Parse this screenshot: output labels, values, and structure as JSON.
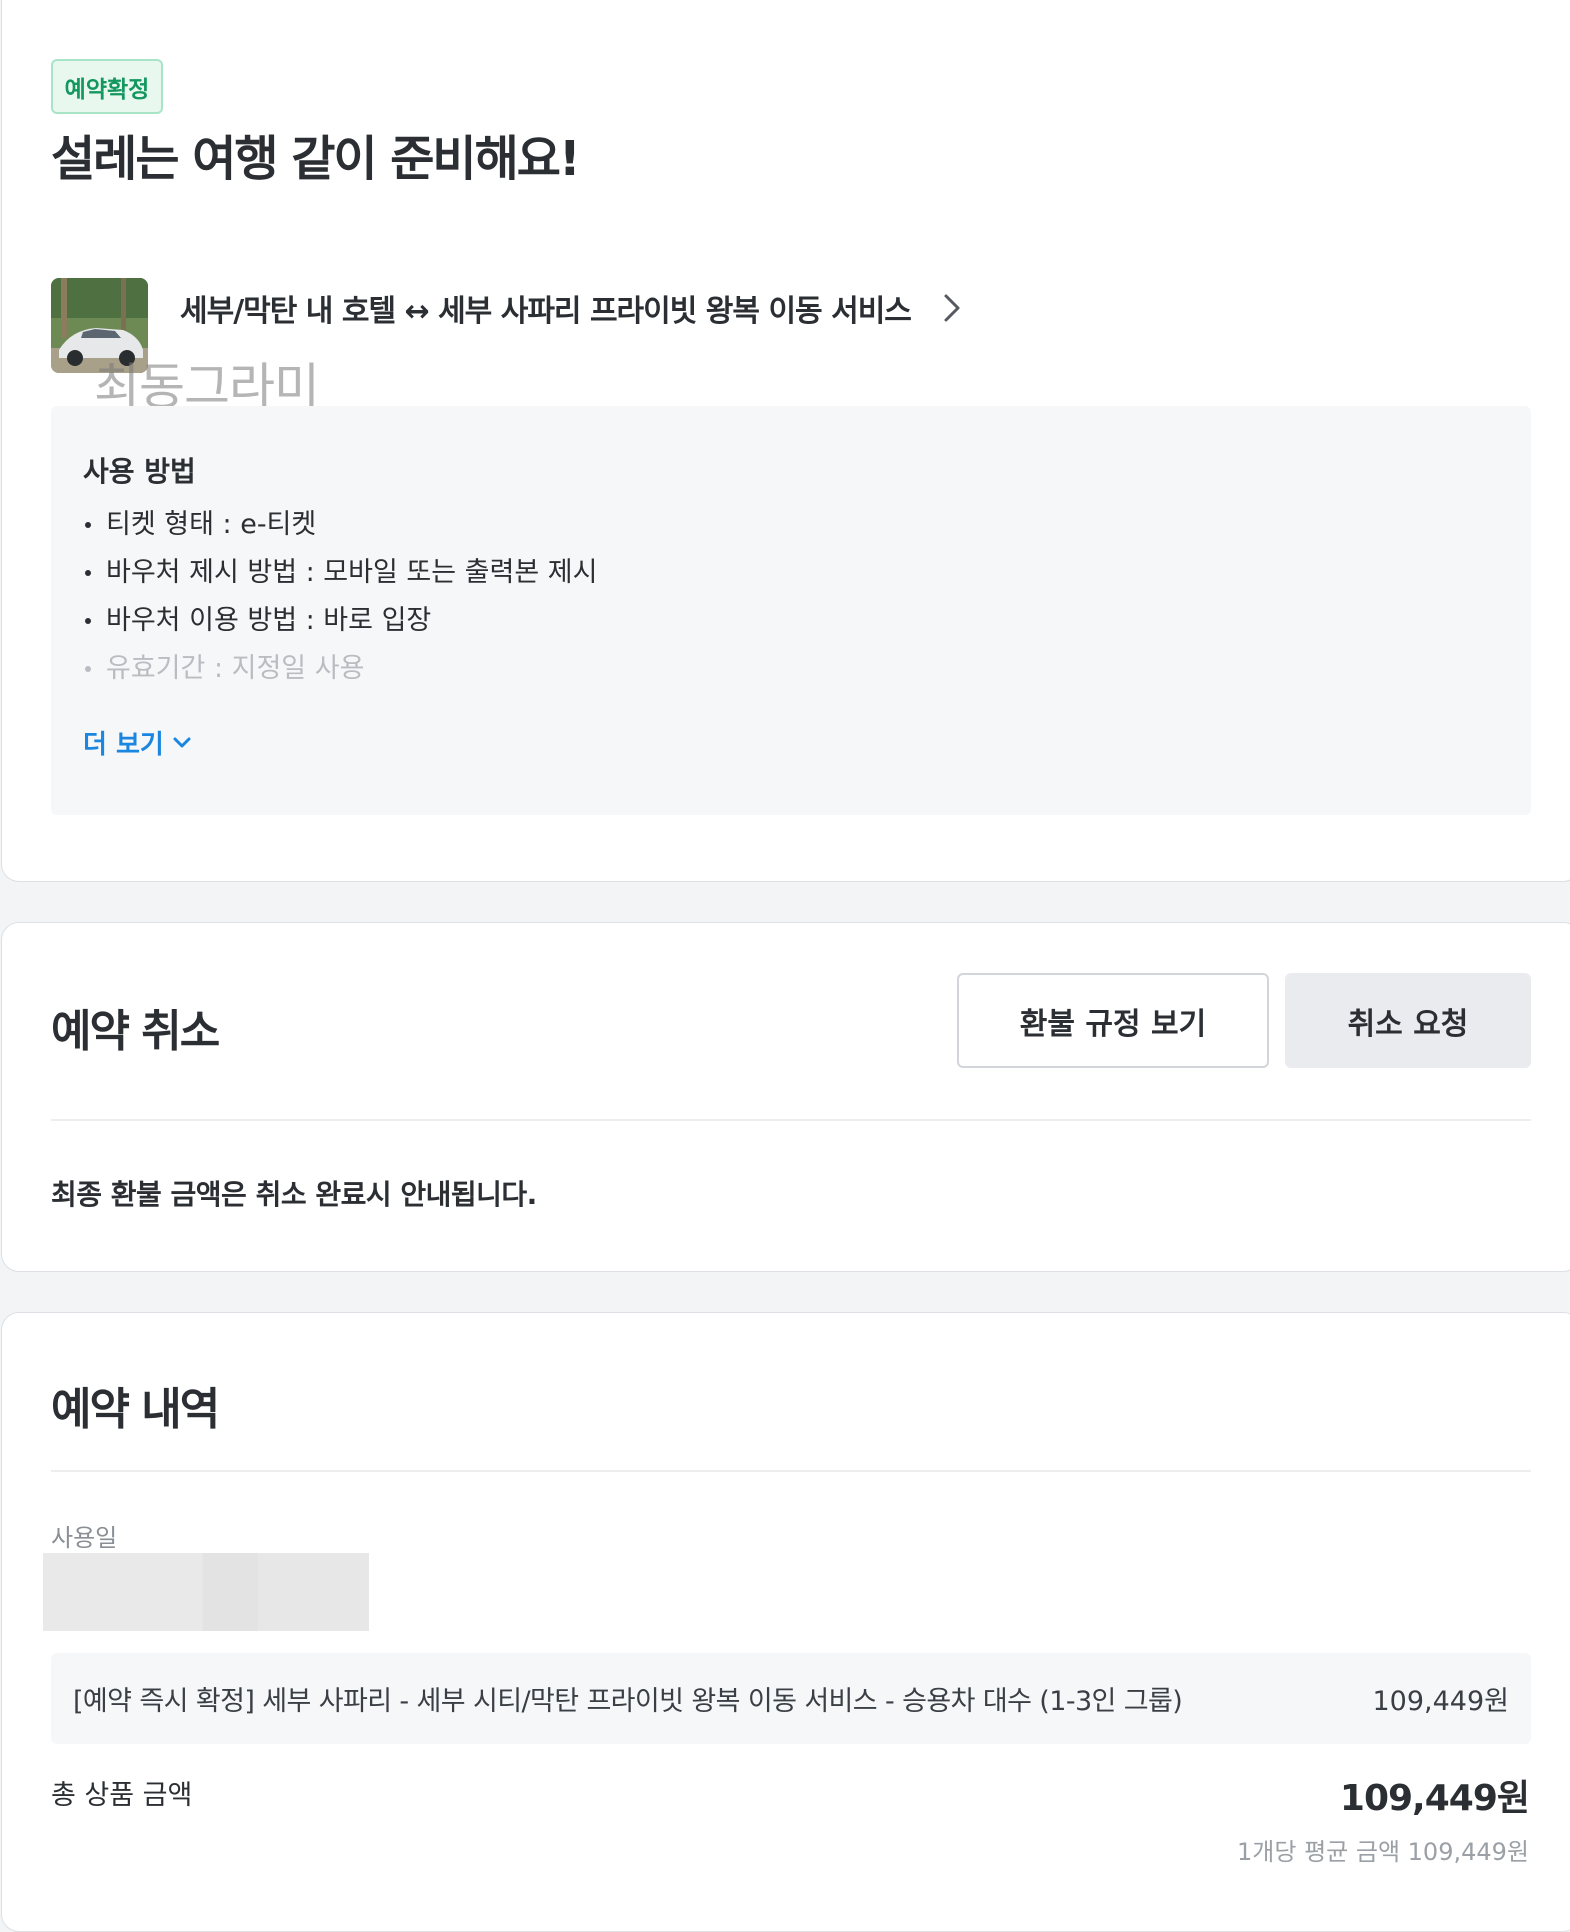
{
  "booking": {
    "status_badge": "예약확정",
    "title": "설레는 여행 같이 준비해요!",
    "product": {
      "title": "세부/막탄 내 호텔 ↔ 세부 사파리 프라이빗 왕복 이동 서비스",
      "thumbnail_icon": "car-photo"
    },
    "watermark": "최동그라미",
    "usage": {
      "title": "사용 방법",
      "items": [
        "티켓 형태 : e-티켓",
        "바우처 제시 방법 : 모바일 또는 출력본 제시",
        "바우처 이용 방법 : 바로 입장",
        "유효기간 : 지정일 사용"
      ],
      "more_label": "더 보기"
    }
  },
  "cancel": {
    "title": "예약 취소",
    "refund_policy_button": "환불 규정 보기",
    "cancel_request_button": "취소 요청",
    "note": "최종 환불 금액은 취소 완료시 안내됩니다."
  },
  "detail": {
    "title": "예약 내역",
    "date_label": "사용일",
    "item_name": "[예약 즉시 확정] 세부 사파리 - 세부 시티/막탄 프라이빗 왕복 이동 서비스 - 승용차 대수 (1-3인 그룹)",
    "item_price": "109,449원",
    "total_label": "총 상품 금액",
    "total_value": "109,449원",
    "avg_price": "1개당 평균 금액 109,449원"
  },
  "colors": {
    "badge_green": "#13975e",
    "link_blue": "#1a86e0",
    "panel_gray": "#f6f7f9"
  }
}
